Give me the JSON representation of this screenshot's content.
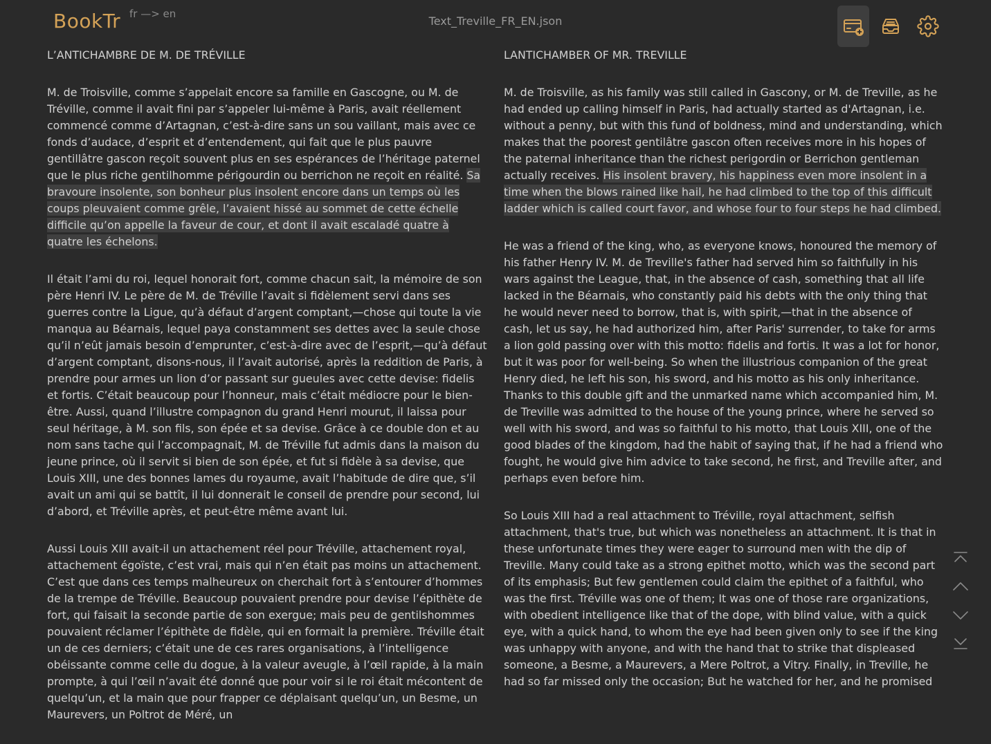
{
  "app": {
    "name": "BookTr",
    "languages": "fr —> en",
    "file": "Text_Treville_FR_EN.json"
  },
  "toolbar": [
    {
      "icon": "card-add-icon",
      "active": true
    },
    {
      "icon": "inbox-icon",
      "active": false
    },
    {
      "icon": "gear-icon",
      "active": false
    }
  ],
  "colors": {
    "brand": "#d4a257",
    "background": "#2a2a2a",
    "highlight": "#3f3f3f"
  },
  "source": {
    "title": "L’ANTICHAMBRE DE M. DE TRÉVILLE",
    "p1": "M. de Troisville, comme s’appelait encore sa famille en Gascogne, ou M. de Tréville, comme il avait fini par s’appeler lui-même à Paris, avait réellement commencé comme d’Artagnan, c’est-à-dire sans un sou vaillant, mais avec ce fonds d’audace, d’esprit et d’entendement, qui fait que le plus pauvre gentillâtre gascon reçoit souvent plus en ses espérances de l’héritage paternel que le plus riche gentilhomme périgourdin ou berrichon ne reçoit en réalité.",
    "p1_hl": "Sa bravoure insolente, son bonheur plus insolent encore dans un temps où les coups pleuvaient comme grêle, l’avaient hissé au sommet de cette échelle difficile qu’on appelle la faveur de cour, et dont il avait escaladé quatre à quatre les échelons.",
    "p2": "Il était l’ami du roi, lequel honorait fort, comme chacun sait, la mémoire de son père Henri IV. Le père de M. de Tréville l’avait si fidèlement servi dans ses guerres contre la Ligue, qu’à défaut d’argent comptant,—chose qui toute la vie manqua au Béarnais, lequel paya constamment ses dettes avec la seule chose qu’il n’eût jamais besoin d’emprunter, c’est-à-dire avec de l’esprit,—qu’à défaut d’argent comptant, disons-nous, il l’avait autorisé, après la reddition de Paris, à prendre pour armes un lion d’or passant sur gueules avec cette devise: fidelis et fortis. C’était beaucoup pour l’honneur, mais c’était médiocre pour le bien-être. Aussi, quand l’illustre compagnon du grand Henri mourut, il laissa pour seul héritage, à M. son fils, son épée et sa devise. Grâce à ce double don et au nom sans tache qui l’accompagnait, M. de Tréville fut admis dans la maison du jeune prince, où il servit si bien de son épée, et fut si fidèle à sa devise, que Louis XIII, une des bonnes lames du royaume, avait l’habitude de dire que, s’il avait un ami qui se battît, il lui donnerait le conseil de prendre pour second, lui d’abord, et Tréville après, et peut-être même avant lui.",
    "p3": "Aussi Louis XIII avait-il un attachement réel pour Tréville, attachement royal, attachement égoïste, c’est vrai, mais qui n’en était pas moins un attachement. C’est que dans ces temps malheureux on cherchait fort à s’entourer d’hommes de la trempe de Tréville. Beaucoup pouvaient prendre pour devise l’épithète de fort, qui faisait la seconde partie de son exergue; mais peu de gentilshommes pouvaient réclamer l’épithète de fidèle, qui en formait la première. Tréville était un de ces derniers; c’était une de ces rares organisations, à l’intelligence obéissante comme celle du dogue, à la valeur aveugle, à l’œil rapide, à la main prompte, à qui l’œil n’avait été donné que pour voir si le roi était mécontent de quelqu’un, et la main que pour frapper ce déplaisant quelqu’un, un Besme, un Maurevers, un Poltrot de Méré, un"
  },
  "target": {
    "title": "LANTICHAMBER OF MR. TREVILLE",
    "p1": "M. de Troisville, as his family was still called in Gascony, or M. de Treville, as he had ended up calling himself in Paris, had actually started as d'Artagnan, i.e. without a penny, but with this fund of boldness, mind and understanding, which makes that the poorest gentilâtre gascon often receives more in his hopes of the paternal inheritance than the richest perigordin or Berrichon gentleman actually receives.",
    "p1_hl": "His insolent bravery, his happiness even more insolent in a time when the blows rained like hail, he had climbed to the top of this difficult ladder which is called court favor, and whose four to four steps he had climbed.",
    "p2": "He was a friend of the king, who, as everyone knows, honoured the memory of his father Henry IV. M. de Treville's father had served him so faithfully in his wars against the League, that, in the absence of cash, something that all life lacked in the Béarnais, who constantly paid his debts with the only thing that he would never need to borrow, that is, with spirit,—that in the absence of cash, let us say, he had authorized him, after Paris' surrender, to take for arms a lion gold passing over with this motto: fidelis and fortis. It was a lot for honor, but it was poor for well-being. So when the illustrious companion of the great Henry died, he left his son, his sword, and his motto as his only inheritance. Thanks to this double gift and the unmarked name which accompanied him, M. de Treville was admitted to the house of the young prince, where he served so well with his sword, and was so faithful to his motto, that Louis XIII, one of the good blades of the kingdom, had the habit of saying that, if he had a friend who fought, he would give him advice to take second, he first, and Treville after, and perhaps even before him.",
    "p3": "So Louis XIII had a real attachment to Tréville, royal attachment, selfish attachment, that's true, but which was nonetheless an attachment. It is that in these unfortunate times they were eager to surround men with the dip of Treville. Many could take as a strong epithet motto, which was the second part of its emphasis; But few gentlemen could claim the epithet of a faithful, who was the first. Tréville was one of them; It was one of those rare organizations, with obedient intelligence like that of the dope, with blind value, with a quick eye, with a quick hand, to whom the eye had been given only to see if the king was unhappy with anyone, and with the hand that to strike that displeased someone, a Besme, a Maurevers, a Mere Poltrot, a Vitry. Finally, in Treville, he had so far missed only the occasion; But he watched for her, and he promised"
  },
  "nav": [
    "scroll-top-icon",
    "page-up-icon",
    "page-down-icon",
    "scroll-bottom-icon"
  ]
}
